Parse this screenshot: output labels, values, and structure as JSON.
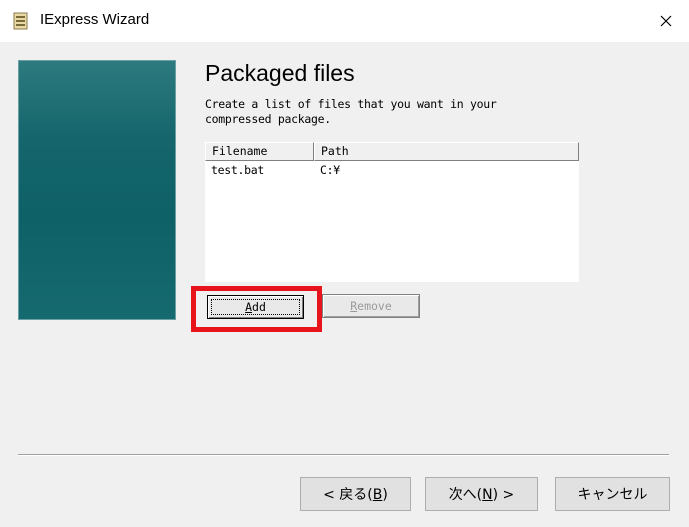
{
  "window": {
    "title": "IExpress Wizard",
    "close_icon": "close-icon",
    "app_icon": "iexpress-app-icon"
  },
  "page": {
    "heading": "Packaged files",
    "description": "Create a list of files that you want in your compressed package."
  },
  "file_list": {
    "columns": [
      "Filename",
      "Path"
    ],
    "rows": [
      {
        "filename": "test.bat",
        "path": "C:¥"
      }
    ]
  },
  "buttons": {
    "add": {
      "prefix": "",
      "mnemonic": "A",
      "suffix": "dd"
    },
    "remove": {
      "prefix": "",
      "mnemonic": "R",
      "suffix": "emove"
    },
    "back": {
      "prefix": "< 戻る(",
      "mnemonic": "B",
      "suffix": ")"
    },
    "next": {
      "prefix": "次へ(",
      "mnemonic": "N",
      "suffix": ") >"
    },
    "cancel": {
      "label": "キャンセル"
    }
  },
  "colors": {
    "highlight": "#e8141b",
    "side_panel": "#0e6166"
  }
}
